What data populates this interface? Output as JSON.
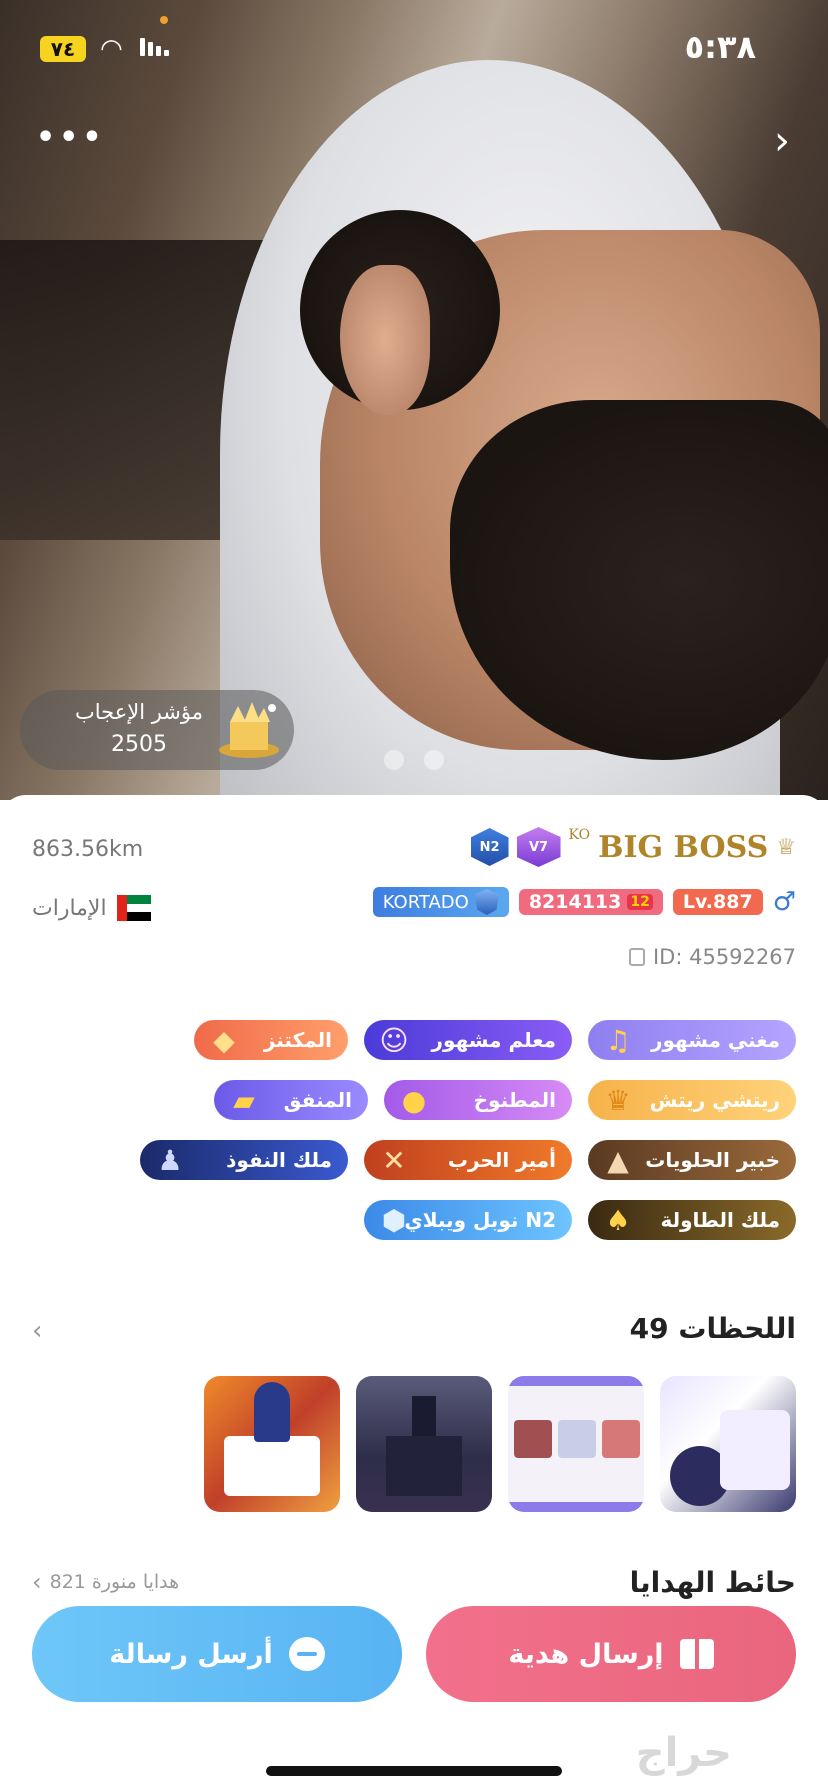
{
  "status_bar": {
    "time": "٥:٣٨",
    "battery": "٧٤"
  },
  "header": {
    "more_label": "•••",
    "back_label": "›"
  },
  "admire": {
    "label": "مؤشر الإعجاب",
    "value": "2505"
  },
  "profile": {
    "name": "BIG BOSS",
    "name_prefix": "KO",
    "vip_badge": "V7",
    "noble_badge": "N2",
    "distance": "863.56km",
    "country": "الإمارات",
    "level": "Lv.887",
    "fans_id": "8214113",
    "fans_rank": "12",
    "family": "KORTADO",
    "id_text": "ID: 45592267"
  },
  "medals": [
    {
      "label": "مغني مشهور",
      "icon": "music-note-icon",
      "color_from": "#8e7ff0",
      "color_to": "#b5a4ff"
    },
    {
      "label": "معلم مشهور",
      "icon": "avatar-icon",
      "color_from": "#4a3bd8",
      "color_to": "#8b5cf6"
    },
    {
      "label": "المكتنز",
      "icon": "gold-icon",
      "color_from": "#f06a4a",
      "color_to": "#ff9f6a"
    },
    {
      "label": "ريتشي ريتش",
      "icon": "coin-crown-icon",
      "color_from": "#f6b24a",
      "color_to": "#ffd27a"
    },
    {
      "label": "المطنوخ",
      "icon": "coins-icon",
      "color_from": "#a35ae8",
      "color_to": "#d68bf5"
    },
    {
      "label": "المنفق",
      "icon": "gold-bars-icon",
      "color_from": "#6b5ae8",
      "color_to": "#9b8bff"
    },
    {
      "label": "خبير الحلويات",
      "icon": "cake-icon",
      "color_from": "#5a3a22",
      "color_to": "#9a6a3a"
    },
    {
      "label": "أمير الحرب",
      "icon": "swords-icon",
      "color_from": "#c0401e",
      "color_to": "#f07a2a"
    },
    {
      "label": "ملك النفوذ",
      "icon": "people-icon",
      "color_from": "#1a2a6a",
      "color_to": "#3a5ad0"
    },
    {
      "label": "ملك الطاولة",
      "icon": "cards-icon",
      "color_from": "#3a2a12",
      "color_to": "#8a6a2a"
    },
    {
      "label": "نوبل ويبلاي N2",
      "icon": "n2-badge-icon",
      "color_from": "#3b8ae8",
      "color_to": "#6ec4ff"
    }
  ],
  "moments": {
    "title": "اللحظات 49"
  },
  "gifts": {
    "title": "حائط الهدايا",
    "count": "821 هدايا منورة"
  },
  "actions": {
    "gift_label": "إرسال هدية",
    "message_label": "أرسل رسالة"
  },
  "watermark": "حراج"
}
